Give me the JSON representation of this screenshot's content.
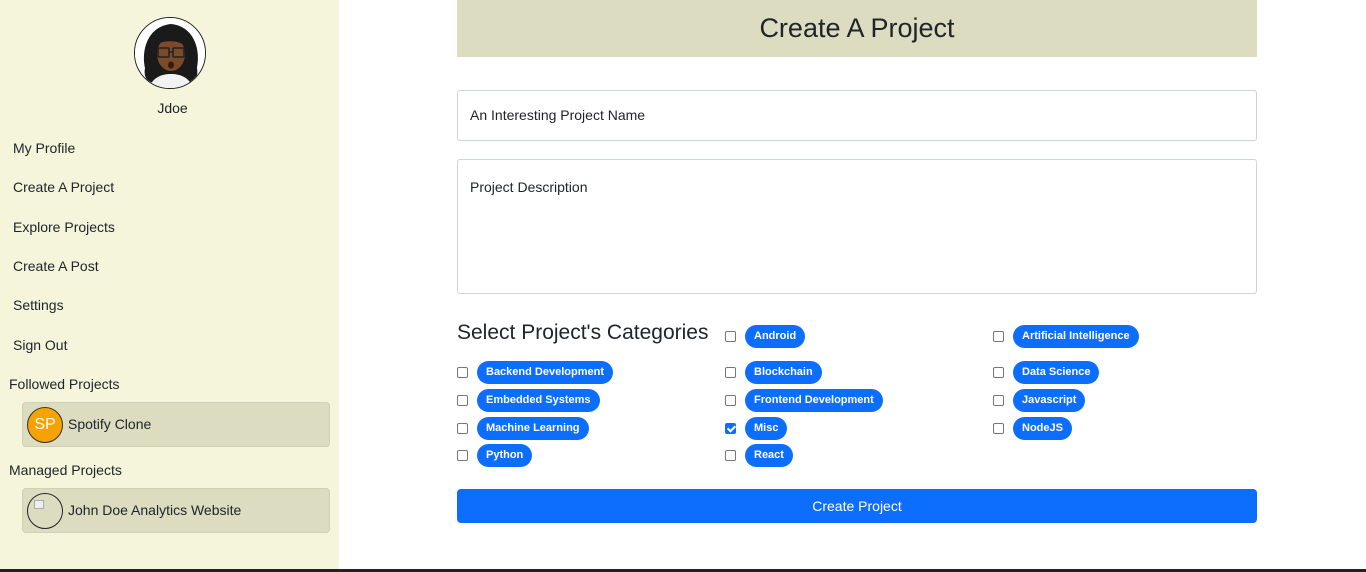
{
  "sidebar": {
    "username": "Jdoe",
    "nav": [
      {
        "label": "My Profile"
      },
      {
        "label": "Create A Project"
      },
      {
        "label": "Explore Projects"
      },
      {
        "label": "Create A Post"
      },
      {
        "label": "Settings"
      },
      {
        "label": "Sign Out"
      }
    ],
    "followed_label": "Followed Projects",
    "followed": [
      {
        "initials": "SP",
        "name": "Spotify Clone"
      }
    ],
    "managed_label": "Managed Projects",
    "managed": [
      {
        "name": "John Doe Analytics Website"
      }
    ]
  },
  "main": {
    "title": "Create A Project",
    "name_placeholder": "An Interesting Project Name",
    "description_placeholder": "Project Description",
    "categories_title": "Select Project's Categories",
    "categories": [
      {
        "label": "Android",
        "checked": false
      },
      {
        "label": "Artificial Intelligence",
        "checked": false
      },
      {
        "label": "Backend Development",
        "checked": false
      },
      {
        "label": "Blockchain",
        "checked": false
      },
      {
        "label": "Data Science",
        "checked": false
      },
      {
        "label": "Embedded Systems",
        "checked": false
      },
      {
        "label": "Frontend Development",
        "checked": false
      },
      {
        "label": "Javascript",
        "checked": false
      },
      {
        "label": "Machine Learning",
        "checked": false
      },
      {
        "label": "Misc",
        "checked": true
      },
      {
        "label": "NodeJS",
        "checked": false
      },
      {
        "label": "Python",
        "checked": false
      },
      {
        "label": "React",
        "checked": false
      }
    ],
    "submit_label": "Create Project"
  },
  "colors": {
    "sidebar_bg": "#f5f5dc",
    "card_bg": "#dcdcc1",
    "accent": "#0d6efd"
  }
}
